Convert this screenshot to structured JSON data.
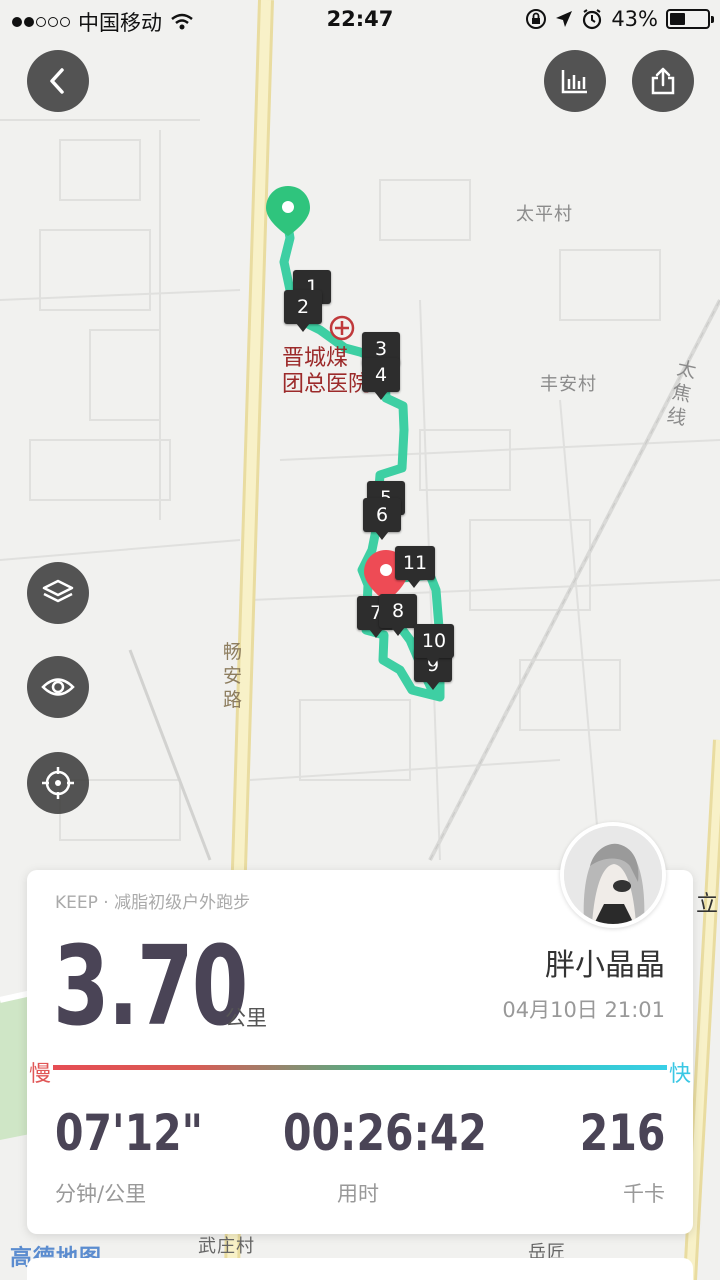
{
  "status_bar": {
    "carrier": "中国移动",
    "time": "22:47",
    "battery": "43%",
    "battery_level": 0.43
  },
  "map": {
    "labels": {
      "taiping": "太平村",
      "fengan": "丰安村",
      "taijiao": "太焦线",
      "changan": "畅安路",
      "hospital": "晋城煤业集团总医院",
      "hospital_line1": "晋城煤",
      "hospital_line2": "团总医院",
      "wuzhuang": "武庄村",
      "yueguan": "岳匠",
      "li": "立",
      "amap": "高德地图"
    },
    "km_markers": [
      "1",
      "2",
      "3",
      "4",
      "5",
      "6",
      "7",
      "8",
      "9",
      "10",
      "11"
    ]
  },
  "toolbar": {
    "back_icon": "chevron-left-icon",
    "chart_icon": "bar-chart-icon",
    "share_icon": "share-icon",
    "layers_icon": "layers-icon",
    "eye_icon": "eye-icon",
    "locate_icon": "crosshair-icon"
  },
  "summary": {
    "tag": "KEEP · 减脂初级户外跑步",
    "distance": "3.70",
    "distance_unit": "公里",
    "username": "胖小晶晶",
    "datetime": "04月10日 21:01",
    "slow_label": "慢",
    "fast_label": "快",
    "stats": [
      {
        "value": "07'12\"",
        "label": "分钟/公里"
      },
      {
        "value": "00:26:42",
        "label": "用时"
      },
      {
        "value": "216",
        "label": "千卡"
      }
    ]
  },
  "colors": {
    "route": "#3ecfa3",
    "start_pin": "#2fc47d",
    "end_pin": "#ee4b55",
    "text_dark": "#4a4456"
  }
}
